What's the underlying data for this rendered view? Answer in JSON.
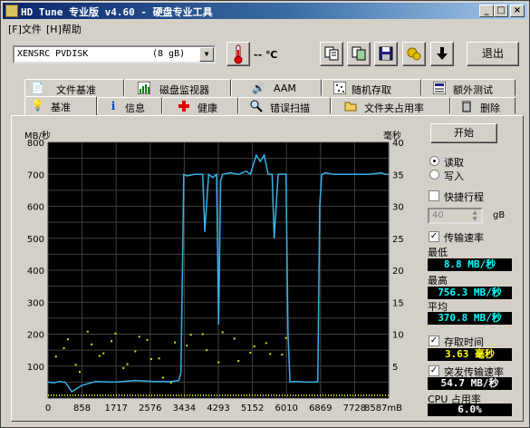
{
  "window": {
    "title": "HD Tune 专业版 v4.60 - 硬盘专业工具",
    "buttons": {
      "minimize": "_",
      "maximize": "□",
      "close": "×"
    }
  },
  "menu": {
    "items": [
      {
        "label": "[F]文件"
      },
      {
        "label": "[H]帮助"
      }
    ]
  },
  "toolbar": {
    "drive_name": "XENSRC  PVDISK",
    "drive_size": "(8 gB)",
    "temperature": "-- ℃",
    "exit_label": "退出",
    "icons": [
      "thermometer-icon",
      "copy-text-icon",
      "copy-screenshot-icon",
      "save-icon",
      "options-icon",
      "download-icon"
    ]
  },
  "tabs": {
    "row_top": [
      {
        "label": "文件基准",
        "icon": "file-benchmark-icon"
      },
      {
        "label": "磁盘监视器",
        "icon": "disk-monitor-icon"
      },
      {
        "label": "AAM",
        "icon": "speaker-icon"
      },
      {
        "label": "随机存取",
        "icon": "random-access-icon"
      },
      {
        "label": "额外测试",
        "icon": "extra-tests-icon"
      }
    ],
    "row_bottom": [
      {
        "label": "基准",
        "icon": "benchmark-icon",
        "active": true
      },
      {
        "label": "信息",
        "icon": "info-icon"
      },
      {
        "label": "健康",
        "icon": "health-icon"
      },
      {
        "label": "错误扫描",
        "icon": "error-scan-icon"
      },
      {
        "label": "文件夹占用率",
        "icon": "folder-usage-icon"
      },
      {
        "label": "删除",
        "icon": "erase-icon"
      }
    ]
  },
  "benchmark": {
    "start_label": "开始",
    "read_label": "读取",
    "write_label": "写入",
    "mode": "read",
    "short_stroke_label": "快捷行程",
    "short_stroke_checked": false,
    "short_stroke_value": "40",
    "short_stroke_unit": "gB",
    "transfer_rate_label": "传输速率",
    "transfer_rate_checked": true,
    "min_label": "最低",
    "min_value": "8.8 MB/秒",
    "max_label": "最高",
    "max_value": "756.3 MB/秒",
    "avg_label": "平均",
    "avg_value": "370.8 MB/秒",
    "access_time_label": "存取时间",
    "access_time_checked": true,
    "access_time_value": "3.63 毫秒",
    "burst_rate_label": "突发传输速率",
    "burst_rate_checked": true,
    "burst_rate_value": "54.7 MB/秒",
    "cpu_label": "CPU 占用率",
    "cpu_value": "6.0%",
    "colors": {
      "min_value": "#00ffff",
      "max_value": "#00ffff",
      "avg_value": "#00ffff",
      "access_time_value": "#ffff00",
      "burst_rate_value": "#ffffff",
      "cpu_value": "#ffffff"
    }
  },
  "chart_data": {
    "type": "line",
    "ylabel": "MB/秒",
    "y2label": "毫秒",
    "ylim": [
      0,
      800
    ],
    "y2lim": [
      0,
      40
    ],
    "xlim": [
      0,
      8587
    ],
    "xunit": "mB",
    "y_ticks": [
      100,
      200,
      300,
      400,
      500,
      600,
      700,
      800
    ],
    "y2_ticks": [
      5,
      10,
      15,
      20,
      25,
      30,
      35,
      40
    ],
    "x_ticks": [
      "0",
      "858",
      "1717",
      "2576",
      "3434",
      "4293",
      "5152",
      "6010",
      "6869",
      "7728",
      "8587mB"
    ],
    "grid": true,
    "colors": {
      "background": "#000000",
      "grid": "#404040",
      "transfer": "#3ab0e8",
      "access": "#e0e000"
    },
    "series": [
      {
        "x": [
          0,
          150,
          300,
          430,
          600,
          860,
          1200,
          1700,
          2200,
          2700,
          3100,
          3300,
          3350,
          3400,
          3420,
          3500,
          3700,
          3900,
          3950,
          4050,
          4150,
          4250,
          4300,
          4350,
          4400,
          4600,
          4800,
          5000,
          5100,
          5150,
          5250,
          5350,
          5450,
          5550,
          5650,
          5700,
          5800,
          5900,
          6000,
          6050,
          6100,
          6200,
          6500,
          6700,
          6800,
          6850,
          6900,
          7000,
          7200,
          7500,
          7800,
          8100,
          8400,
          8500,
          8587
        ],
        "values": [
          50,
          48,
          52,
          50,
          20,
          40,
          52,
          50,
          55,
          52,
          52,
          55,
          80,
          500,
          700,
          695,
          700,
          700,
          520,
          700,
          690,
          700,
          230,
          680,
          700,
          705,
          700,
          710,
          700,
          720,
          760,
          740,
          760,
          700,
          700,
          500,
          700,
          700,
          700,
          200,
          50,
          52,
          50,
          50,
          52,
          600,
          700,
          705,
          700,
          700,
          700,
          700,
          705,
          700,
          700
        ]
      },
      {
        "type": "scatter",
        "x": [
          200,
          500,
          800,
          1100,
          1400,
          1700,
          2000,
          2300,
          2600,
          2900,
          3200,
          3600,
          4000,
          4400,
          4800,
          5200,
          5600,
          6000,
          400,
          700,
          1000,
          1300,
          1600,
          1900,
          2200,
          2500,
          2800,
          3100,
          3500,
          3900,
          4300,
          4700,
          5100,
          5500,
          5900
        ],
        "values": [
          6.5,
          9.2,
          4.1,
          8.4,
          7.0,
          10.1,
          5.3,
          9.6,
          6.1,
          3.2,
          8.7,
          9.9,
          7.5,
          10.3,
          5.8,
          8.1,
          6.9,
          9.4,
          7.8,
          5.2,
          10.4,
          6.6,
          8.9,
          4.7,
          7.3,
          9.1,
          6.2,
          2.4,
          8.2,
          10.0,
          5.6,
          9.3,
          7.1,
          8.6,
          6.8
        ]
      }
    ]
  }
}
